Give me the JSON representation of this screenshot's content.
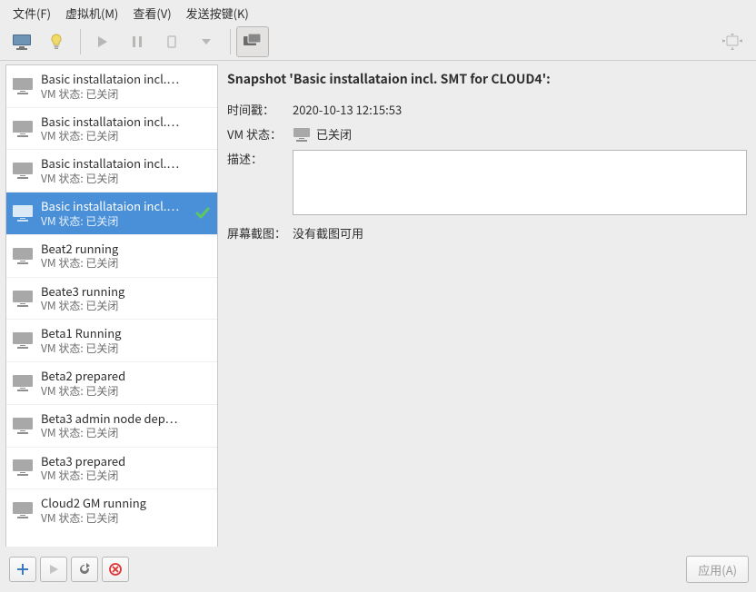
{
  "menu": {
    "file": "文件(F)",
    "vm": "虚拟机(M)",
    "view": "查看(V)",
    "sendkey": "发送按键(K)"
  },
  "toolbar_icons": {
    "monitor": "monitor-icon",
    "bulb": "lightbulb-icon",
    "play": "play-icon",
    "pause": "pause-icon",
    "shutdown": "power-icon",
    "dropdown": "chevron-down-icon",
    "snapshots": "snapshots-icon",
    "fullscreen": "fullscreen-icon"
  },
  "snapshots": [
    {
      "title": "Basic installataion incl.…",
      "sub": "VM 状态: 已关闭",
      "selected": false
    },
    {
      "title": "Basic installataion incl.…",
      "sub": "VM 状态: 已关闭",
      "selected": false
    },
    {
      "title": "Basic installataion incl.…",
      "sub": "VM 状态: 已关闭",
      "selected": false
    },
    {
      "title": "Basic installataion incl.…",
      "sub": "VM 状态: 已关闭",
      "selected": true
    },
    {
      "title": "Beat2 running",
      "sub": "VM 状态: 已关闭",
      "selected": false
    },
    {
      "title": "Beate3 running",
      "sub": "VM 状态: 已关闭",
      "selected": false
    },
    {
      "title": "Beta1 Running",
      "sub": "VM 状态: 已关闭",
      "selected": false
    },
    {
      "title": "Beta2 prepared",
      "sub": "VM 状态: 已关闭",
      "selected": false
    },
    {
      "title": "Beta3 admin node dep…",
      "sub": "VM 状态: 已关闭",
      "selected": false
    },
    {
      "title": "Beta3 prepared",
      "sub": "VM 状态: 已关闭",
      "selected": false
    },
    {
      "title": "Cloud2 GM running",
      "sub": "VM 状态: 已关闭",
      "selected": false
    }
  ],
  "details": {
    "header": "Snapshot 'Basic installataion incl. SMT for CLOUD4':",
    "labels": {
      "timestamp": "时间戳：",
      "vmstate": "VM 状态：",
      "description": "描述：",
      "screenshot": "屏幕截图："
    },
    "timestamp": "2020-10-13 12:15:53",
    "vmstate": "已关闭",
    "screenshot_value": "没有截图可用",
    "description_value": ""
  },
  "footer": {
    "apply": "应用(A)"
  }
}
